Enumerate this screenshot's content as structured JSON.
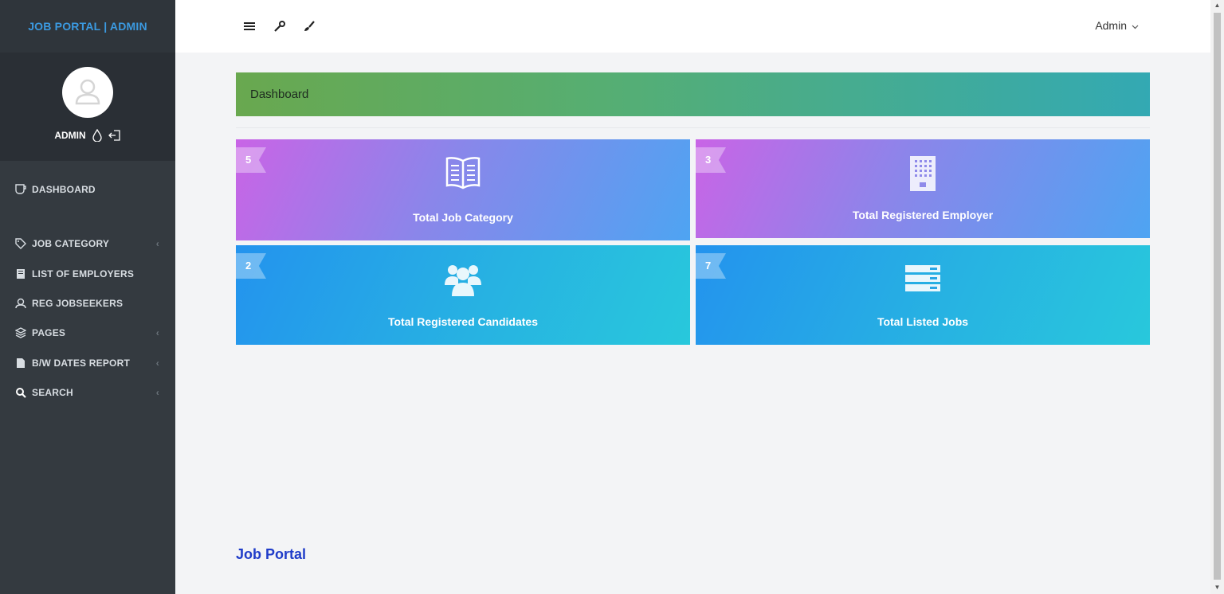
{
  "sidebar": {
    "brand": "JOB PORTAL | ADMIN",
    "user": "ADMIN",
    "items": [
      {
        "label": "DASHBOARD",
        "icon": "coffee-cup-icon"
      },
      {
        "label": "JOB CATEGORY",
        "icon": "tag-icon",
        "has_submenu": true
      },
      {
        "label": "LIST OF EMPLOYERS",
        "icon": "file-icon"
      },
      {
        "label": "REG JOBSEEKERS",
        "icon": "user-icon"
      },
      {
        "label": "PAGES",
        "icon": "layers-icon",
        "has_submenu": true
      },
      {
        "label": "B/W DATES REPORT",
        "icon": "document-icon",
        "has_submenu": true
      },
      {
        "label": "SEARCH",
        "icon": "search-icon",
        "has_submenu": true
      }
    ]
  },
  "topbar": {
    "admin_label": "Admin",
    "icons": [
      "hamburger-menu-icon",
      "wrench-icon",
      "brush-icon"
    ]
  },
  "banner": {
    "title": "Dashboard"
  },
  "cards": [
    {
      "count": "5",
      "label": "Total Job Category",
      "icon": "open-book-icon"
    },
    {
      "count": "3",
      "label": "Total Registered Employer",
      "icon": "building-icon"
    },
    {
      "count": "2",
      "label": "Total Registered Candidates",
      "icon": "users-group-icon"
    },
    {
      "count": "7",
      "label": "Total Listed Jobs",
      "icon": "server-list-icon"
    }
  ],
  "footer": {
    "text": "Job Portal"
  },
  "colors": {
    "sidebar_bg": "#343a40",
    "brand_text": "#3b9ae1",
    "footer_text": "#1f3cc9"
  }
}
